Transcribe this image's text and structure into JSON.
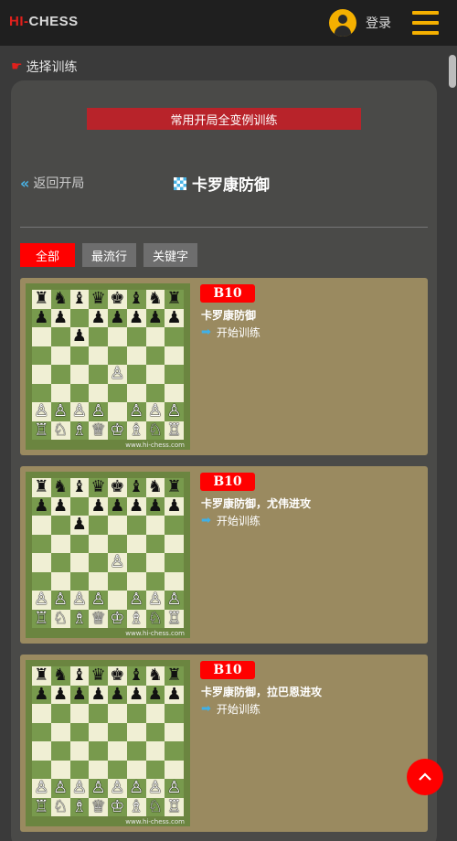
{
  "header": {
    "logo_hi": "HI-",
    "logo_chess": "CHESS",
    "login_label": "登录",
    "user_icon": "user-icon",
    "menu_icon": "hamburger-menu-icon"
  },
  "section_label": "选择训练",
  "panel": {
    "banner": "常用开局全变例训练",
    "back_label": "返回开局",
    "title": "卡罗康防御"
  },
  "filters": [
    {
      "label": "全部",
      "active": true
    },
    {
      "label": "最流行",
      "active": false
    },
    {
      "label": "关键字",
      "active": false
    }
  ],
  "cards": [
    {
      "eco": "B10",
      "name": "卡罗康防御",
      "start_label": "开始训练",
      "watermark": "www.hi-chess.com",
      "board": [
        "rnbqkbnr",
        "pp.ppppp",
        "..p.....",
        "........",
        "....P...",
        "........",
        "PPPP.PPP",
        "RNBQKBNR"
      ]
    },
    {
      "eco": "B10",
      "name": "卡罗康防御，尤伟进攻",
      "start_label": "开始训练",
      "watermark": "www.hi-chess.com",
      "board": [
        "rnbqkbnr",
        "pp.ppppp",
        "..p.....",
        "........",
        "....P...",
        "........",
        "PPPP.PPP",
        "RNBQKBNR"
      ]
    },
    {
      "eco": "B10",
      "name": "卡罗康防御，拉巴恩进攻",
      "start_label": "开始训练",
      "watermark": "www.hi-chess.com",
      "board": [
        "rnbqkbnr",
        "pppppppp",
        "........",
        "........",
        "........",
        "........",
        "PPPPPPPP",
        "RNBQKBNR"
      ]
    }
  ],
  "colors": {
    "accent_red": "#ff0000",
    "accent_yellow": "#f5b000",
    "link_blue": "#3fb0e8",
    "card_bg": "#9a8a60"
  }
}
